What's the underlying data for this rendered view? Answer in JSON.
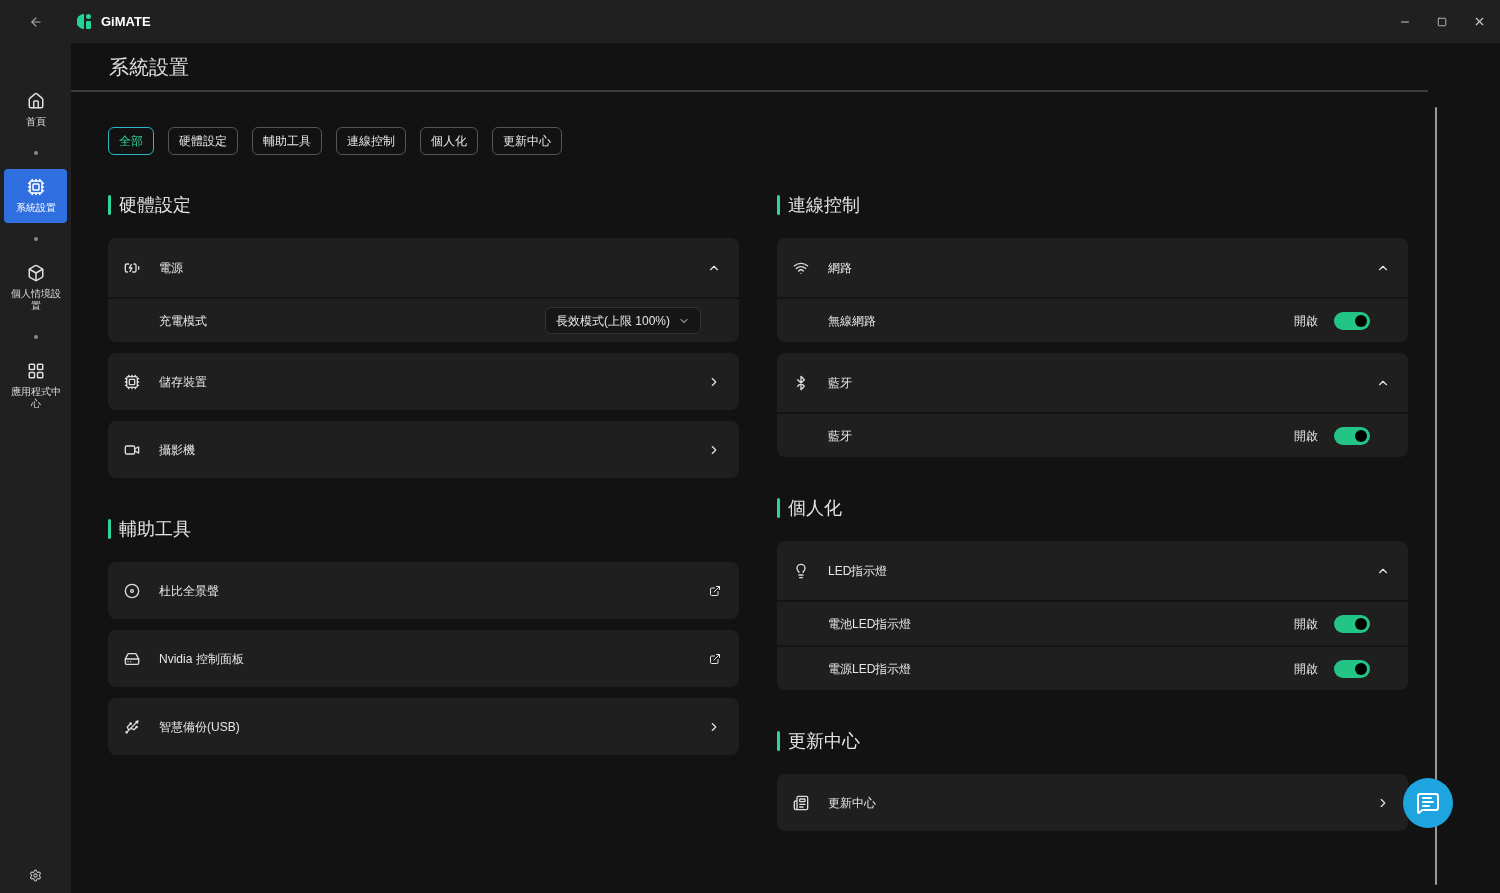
{
  "app": {
    "name": "GiMATE"
  },
  "sidebar": {
    "items": [
      {
        "label": "首頁",
        "selected": false
      },
      {
        "label": "系統設置",
        "selected": true
      },
      {
        "label": "個人情境設置",
        "selected": false
      },
      {
        "label": "應用程式中心",
        "selected": false
      }
    ]
  },
  "page_title": "系統設置",
  "filters": [
    {
      "label": "全部",
      "selected": true
    },
    {
      "label": "硬體設定",
      "selected": false
    },
    {
      "label": "輔助工具",
      "selected": false
    },
    {
      "label": "連線控制",
      "selected": false
    },
    {
      "label": "個人化",
      "selected": false
    },
    {
      "label": "更新中心",
      "selected": false
    }
  ],
  "columns": [
    [
      {
        "title": "硬體設定",
        "cards": [
          {
            "label": "電源",
            "kind": "expandable",
            "expanded": true,
            "rows": [
              {
                "label": "充電模式",
                "kind": "select",
                "value": "長效模式(上限 100%)"
              }
            ]
          },
          {
            "label": "儲存裝置",
            "kind": "link"
          },
          {
            "label": "攝影機",
            "kind": "link"
          }
        ]
      },
      {
        "title": "輔助工具",
        "cards": [
          {
            "label": "杜比全景聲",
            "kind": "external"
          },
          {
            "label": "Nvidia 控制面板",
            "kind": "external"
          },
          {
            "label": "智慧備份(USB)",
            "kind": "link"
          }
        ]
      }
    ],
    [
      {
        "title": "連線控制",
        "cards": [
          {
            "label": "網路",
            "kind": "expandable",
            "expanded": true,
            "rows": [
              {
                "label": "無線網路",
                "kind": "toggle",
                "state_label": "開啟",
                "on": true
              }
            ]
          },
          {
            "label": "藍牙",
            "kind": "expandable",
            "expanded": true,
            "rows": [
              {
                "label": "藍牙",
                "kind": "toggle",
                "state_label": "開啟",
                "on": true
              }
            ]
          }
        ]
      },
      {
        "title": "個人化",
        "cards": [
          {
            "label": "LED指示燈",
            "kind": "expandable",
            "expanded": true,
            "rows": [
              {
                "label": "電池LED指示燈",
                "kind": "toggle",
                "state_label": "開啟",
                "on": true
              },
              {
                "label": "電源LED指示燈",
                "kind": "toggle",
                "state_label": "開啟",
                "on": true
              }
            ]
          }
        ]
      },
      {
        "title": "更新中心",
        "cards": [
          {
            "label": "更新中心",
            "kind": "link"
          }
        ]
      }
    ]
  ]
}
